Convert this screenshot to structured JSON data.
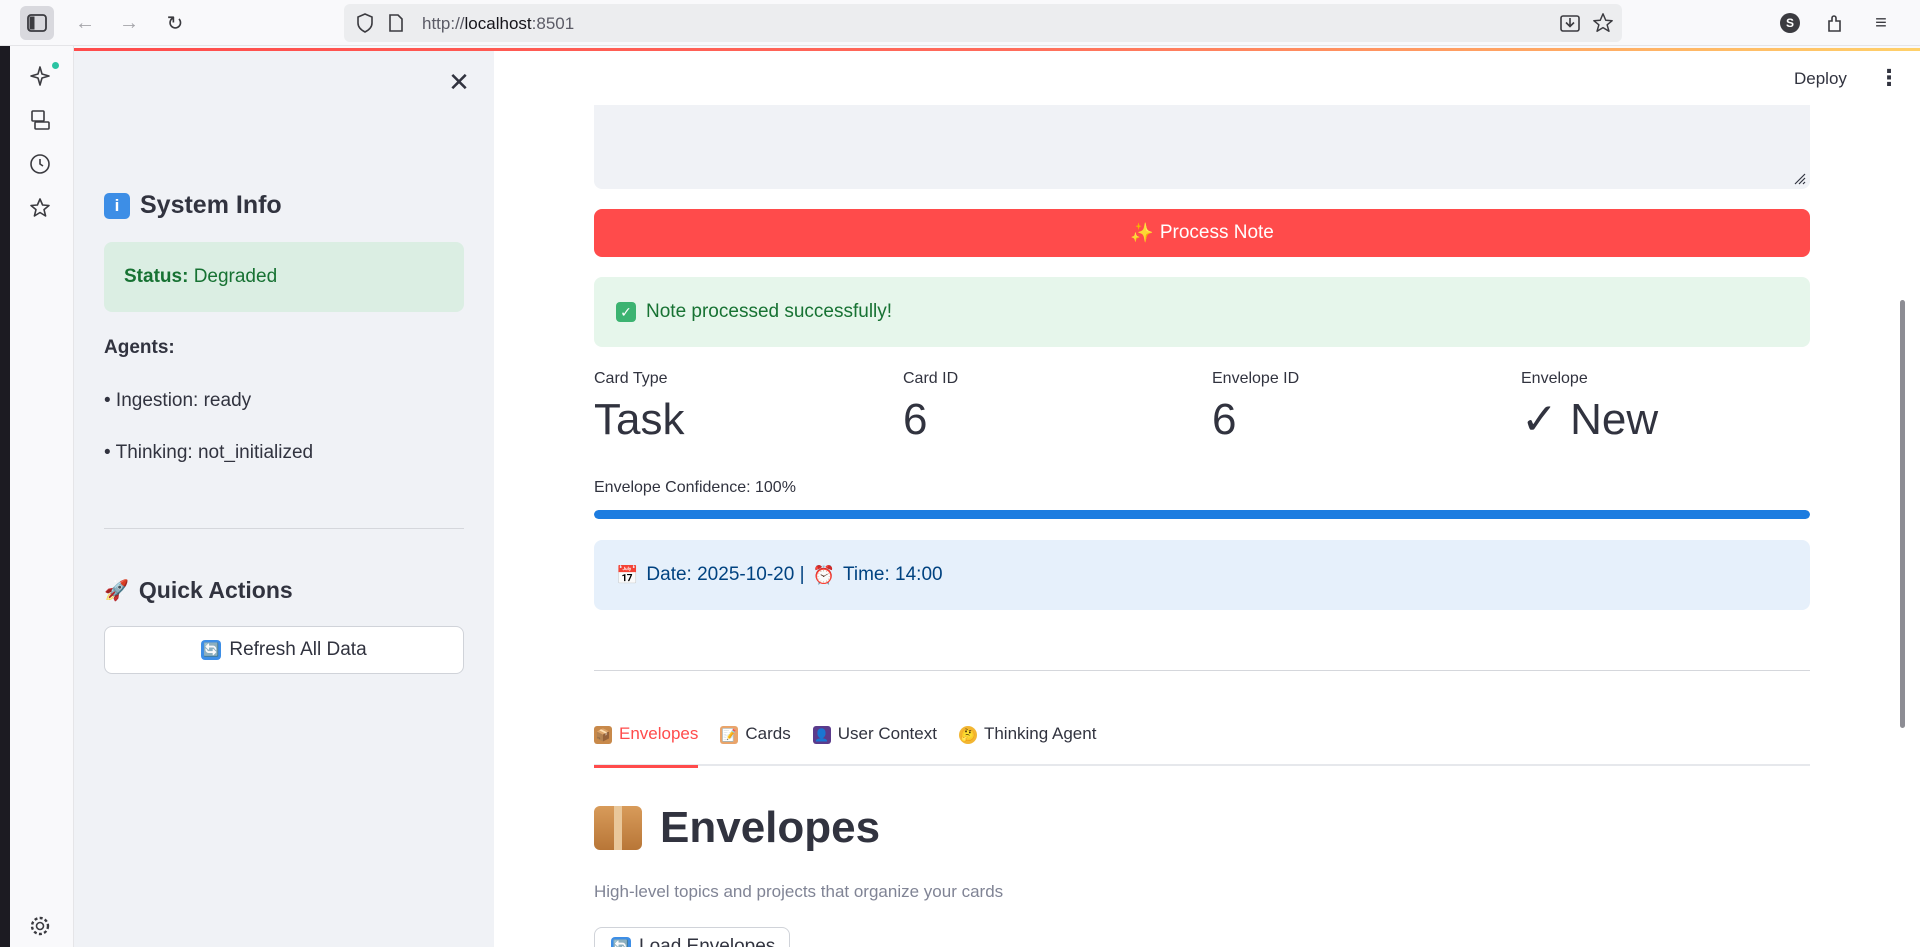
{
  "browser": {
    "url_prefix": "http://",
    "url_host": "localhost",
    "url_port": ":8501",
    "profile_initial": "S"
  },
  "sidebar": {
    "close_glyph": "✕",
    "system_info": {
      "icon_glyph": "i",
      "title": "System Info",
      "status_label": "Status:",
      "status_value": "Degraded"
    },
    "agents_heading": "Agents:",
    "agents": [
      "• Ingestion: ready",
      "• Thinking: not_initialized"
    ],
    "quick_actions": {
      "icon_glyph": "🚀",
      "title": "Quick Actions",
      "refresh_label": "Refresh All Data",
      "refresh_icon_glyph": "🔄"
    }
  },
  "header": {
    "deploy_label": "Deploy",
    "menu_glyph": "⋮"
  },
  "form": {
    "process_label": "Process Note",
    "process_icon_glyph": "✨"
  },
  "result": {
    "success_message": "Note processed successfully!",
    "success_icon_glyph": "✓",
    "metrics": [
      {
        "label": "Card Type",
        "value": "Task"
      },
      {
        "label": "Card ID",
        "value": "6"
      },
      {
        "label": "Envelope ID",
        "value": "6"
      },
      {
        "label": "Envelope",
        "value": "✓ New"
      }
    ],
    "confidence_label": "Envelope Confidence: 100%",
    "confidence_fraction": 1.0,
    "date_text": "Date: 2025-10-20 |",
    "time_text": "Time: 14:00",
    "date_icon_glyph": "📅",
    "time_icon_glyph": "⏰"
  },
  "tabs": [
    {
      "label": "Envelopes",
      "icon_glyph": "📦",
      "active": true
    },
    {
      "label": "Cards",
      "icon_glyph": "📝",
      "active": false
    },
    {
      "label": "User Context",
      "icon_glyph": "👤",
      "active": false
    },
    {
      "label": "Thinking Agent",
      "icon_glyph": "🤔",
      "active": false
    }
  ],
  "envelopes_section": {
    "title": "Envelopes",
    "subtitle": "High-level topics and projects that organize your cards",
    "load_button_label": "Load Envelopes",
    "load_button_icon_glyph": "🔄"
  },
  "colors": {
    "primary_red": "#ff4b4b",
    "success_green": "#177233",
    "info_blue": "#004280",
    "progress_blue": "#1c7ce0"
  }
}
